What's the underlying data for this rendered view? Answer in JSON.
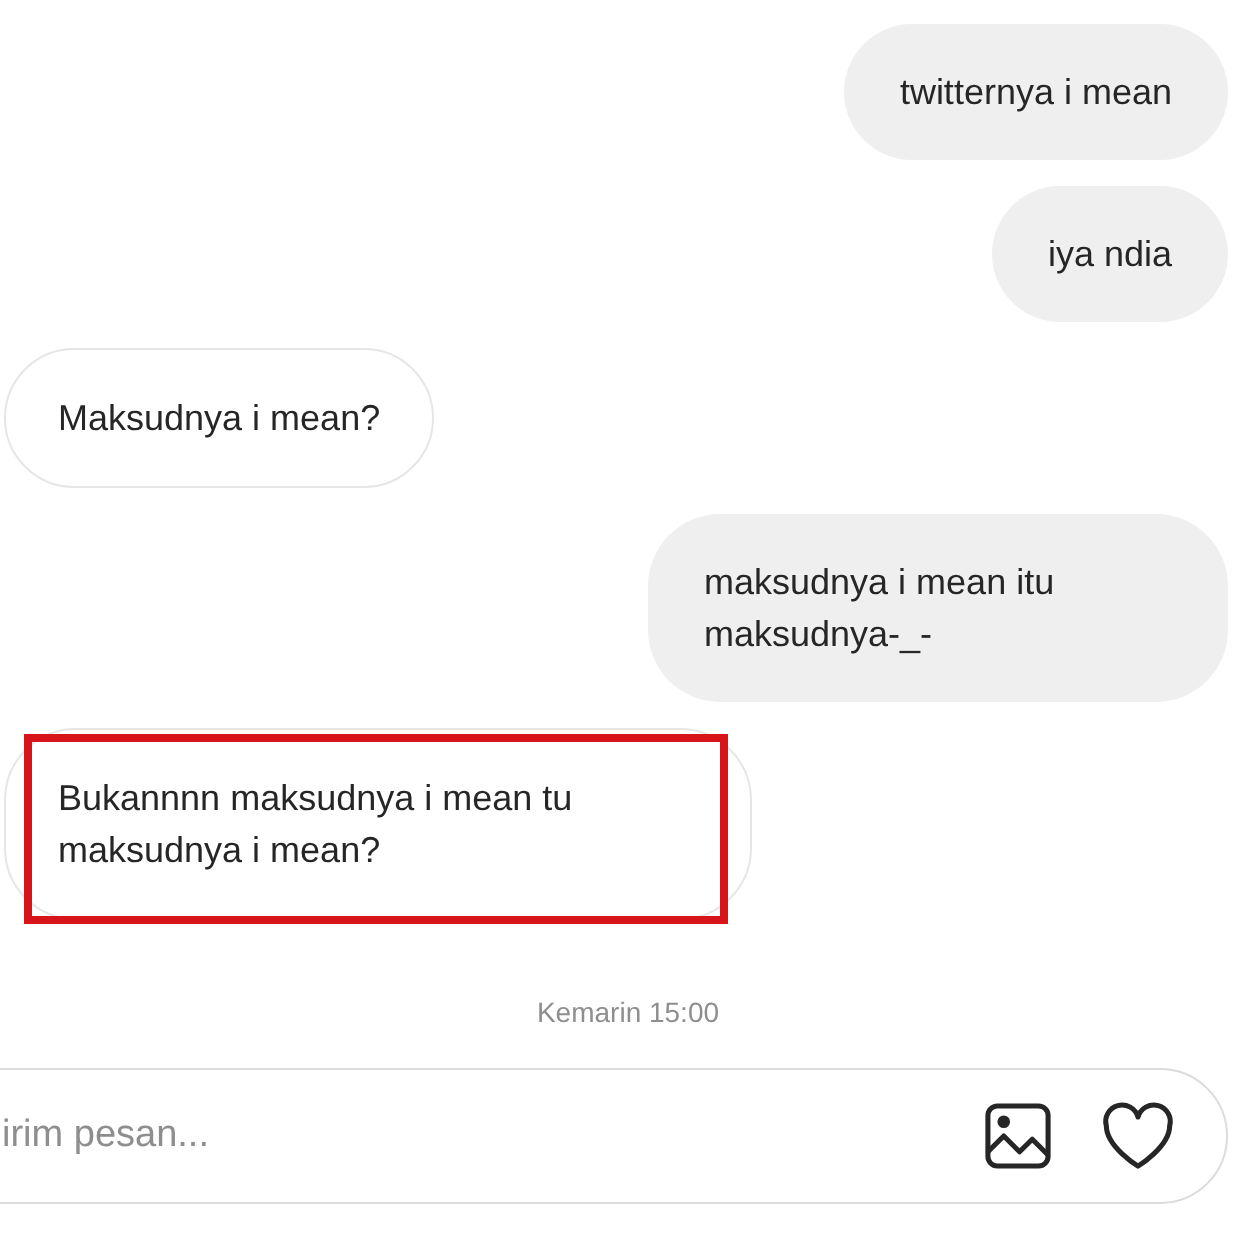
{
  "messages": [
    {
      "kind": "sent",
      "text": "twitternya i mean",
      "highlighted": false
    },
    {
      "kind": "sent",
      "text": "iya ndia",
      "highlighted": false
    },
    {
      "kind": "received",
      "text": "Maksudnya i mean?",
      "highlighted": false
    },
    {
      "kind": "sent",
      "text": "maksudnya i mean itu maksudnya-_-",
      "highlighted": false
    },
    {
      "kind": "received",
      "text": "Bukannnn maksudnya i mean tu maksudnya i mean?",
      "highlighted": true
    }
  ],
  "timestamp": "Kemarin 15:00",
  "composer": {
    "placeholder": "irim pesan..."
  }
}
